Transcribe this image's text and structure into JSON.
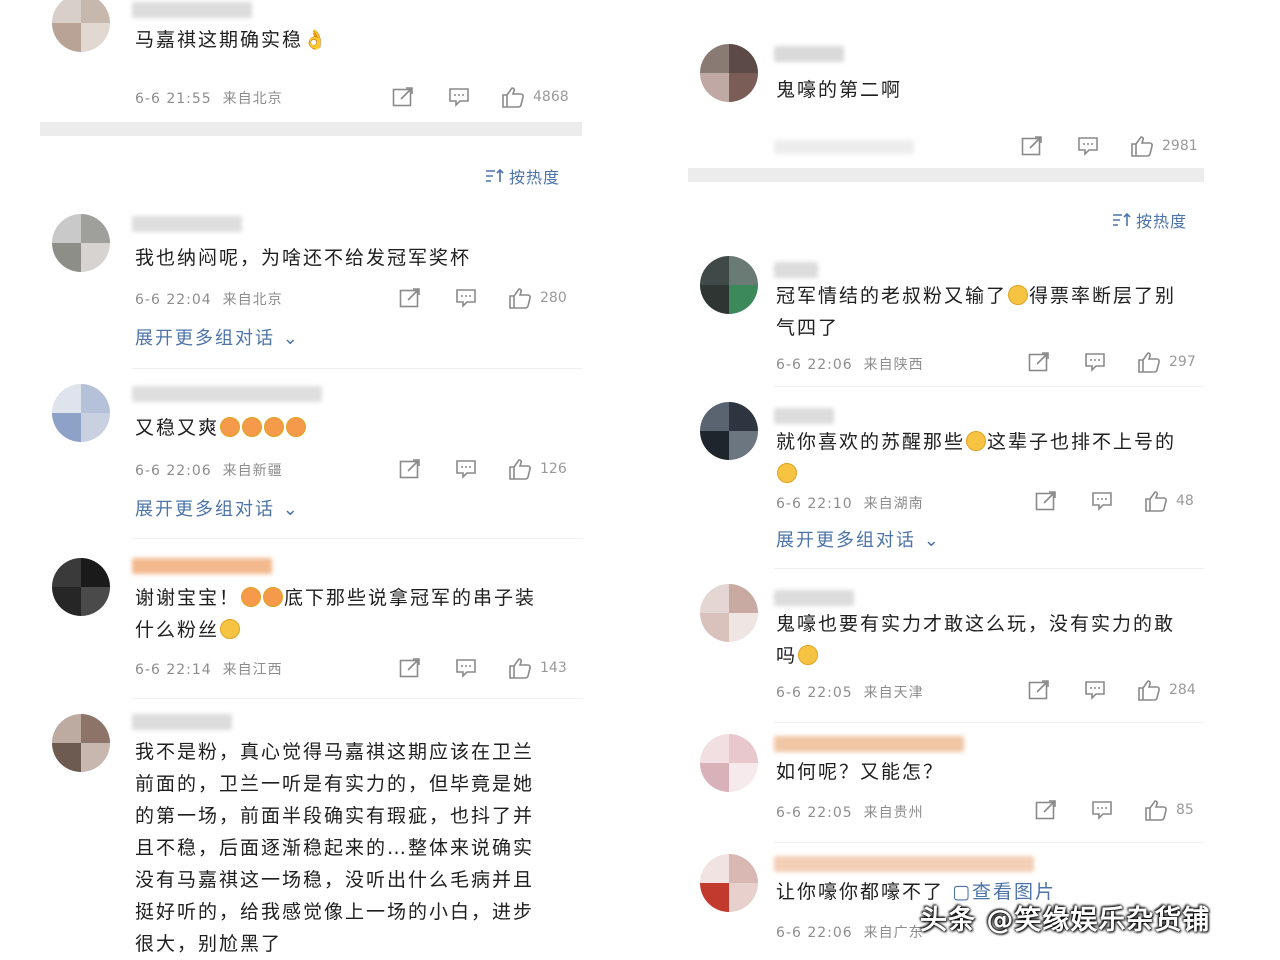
{
  "left_column": {
    "sort_label": "按热度",
    "comments": [
      {
        "text": "马嘉祺这期确实稳👌",
        "time": "6-6 21:55",
        "location": "来自北京",
        "likes": "4868",
        "expand": ""
      },
      {
        "text": "我也纳闷呢，为啥还不给发冠军奖杯",
        "time": "6-6 22:04",
        "location": "来自北京",
        "likes": "280",
        "expand": "展开更多组对话"
      },
      {
        "text": "又稳又爽",
        "time": "6-6 22:06",
        "location": "来自新疆",
        "likes": "126",
        "expand": "展开更多组对话"
      },
      {
        "text_line1": "谢谢宝宝！",
        "text_line1b": "底下那些说拿冠军的串子装",
        "text_line2": "什么粉丝",
        "time": "6-6 22:14",
        "location": "来自江西",
        "likes": "143"
      },
      {
        "lines": [
          "我不是粉，真心觉得马嘉祺这期应该在卫兰",
          "前面的，卫兰一听是有实力的，但毕竟是她",
          "的第一场，前面半段确实有瑕疵，也抖了并",
          "且不稳，后面逐渐稳起来的…整体来说确实",
          "没有马嘉祺这一场稳，没听出什么毛病并且",
          "挺好听的，给我感觉像上一场的小白，进步",
          "很大，别尬黑了"
        ]
      }
    ]
  },
  "right_column": {
    "sort_label": "按热度",
    "comments": [
      {
        "text": "鬼嚎的第二啊",
        "likes": "2981"
      },
      {
        "line1": "冠军情结的老叔粉又输了",
        "line1b": "得票率断层了别",
        "line2": "气四了",
        "time": "6-6 22:06",
        "location": "来自陕西",
        "likes": "297"
      },
      {
        "line1": "就你喜欢的苏醒那些",
        "line1b": "这辈子也排不上号的",
        "time": "6-6 22:10",
        "location": "来自湖南",
        "likes": "48",
        "expand": "展开更多组对话"
      },
      {
        "line1": "鬼嚎也要有实力才敢这么玩，没有实力的敢",
        "line2": "吗",
        "time": "6-6 22:05",
        "location": "来自天津",
        "likes": "284"
      },
      {
        "text": "如何呢？又能怎？",
        "time": "6-6 22:05",
        "location": "来自贵州",
        "likes": "85"
      },
      {
        "text": "让你嚎你都嚎不了",
        "pic_link": "查看图片",
        "time": "6-6 22:06",
        "location": "来自广东"
      }
    ]
  },
  "watermark": "头条 @笑缘娱乐杂货铺",
  "colors": {
    "link": "#4c74a9",
    "meta": "#8d8d8d",
    "divider": "#ececec"
  }
}
